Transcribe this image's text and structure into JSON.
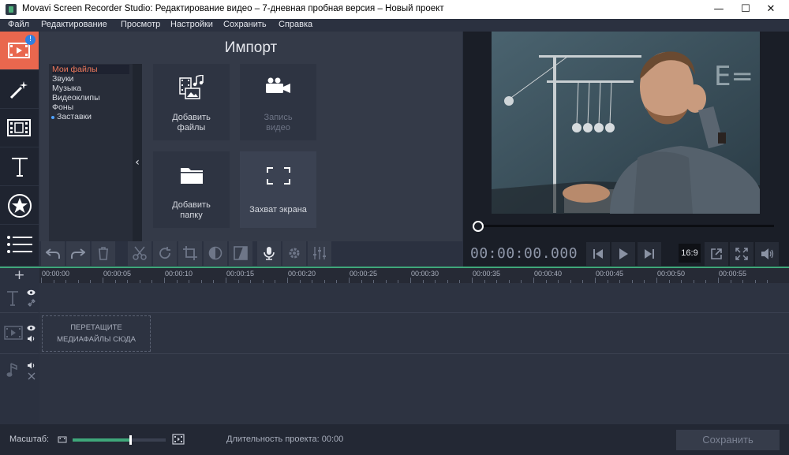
{
  "window": {
    "title": "Movavi Screen Recorder Studio: Редактирование видео – 7-дневная пробная версия – Новый проект"
  },
  "menu": {
    "items": [
      "Файл",
      "Редактирование",
      "Просмотр",
      "Настройки",
      "Сохранить",
      "Справка"
    ]
  },
  "left_toolbar": {
    "badge": "!",
    "tools": [
      "import-icon",
      "magic-wand-icon",
      "filters-icon",
      "titles-icon",
      "stickers-icon",
      "more-icon"
    ]
  },
  "import": {
    "title": "Импорт",
    "file_categories": [
      {
        "label": "Мои файлы",
        "selected": true
      },
      {
        "label": "Звуки"
      },
      {
        "label": "Музыка"
      },
      {
        "label": "Видеоклипы"
      },
      {
        "label": "Фоны"
      },
      {
        "label": "Заставки",
        "dot": true
      }
    ],
    "tiles": {
      "add_files_line1": "Добавить",
      "add_files_line2": "файлы",
      "record_video_line1": "Запись",
      "record_video_line2": "видео",
      "add_folder_line1": "Добавить",
      "add_folder_line2": "папку",
      "screen_capture": "Захват экрана"
    }
  },
  "player": {
    "timecode": "00:00:00.000",
    "aspect_ratio": "16:9",
    "progress": 0
  },
  "timeline": {
    "ticks": [
      "00:00:00",
      "00:00:05",
      "00:00:10",
      "00:00:15",
      "00:00:20",
      "00:00:25",
      "00:00:30",
      "00:00:35",
      "00:00:40",
      "00:00:45",
      "00:00:50",
      "00:00:55"
    ],
    "dropzone_line1": "ПЕРЕТАЩИТЕ",
    "dropzone_line2": "МЕДИАФАЙЛЫ СЮДА"
  },
  "footer": {
    "scale_label": "Масштаб:",
    "scale_value": 0.62,
    "duration_label": "Длительность проекта: 00:00",
    "save_label": "Сохранить"
  },
  "colors": {
    "accent": "#e9674e",
    "timeline_green": "#3fa77a"
  }
}
